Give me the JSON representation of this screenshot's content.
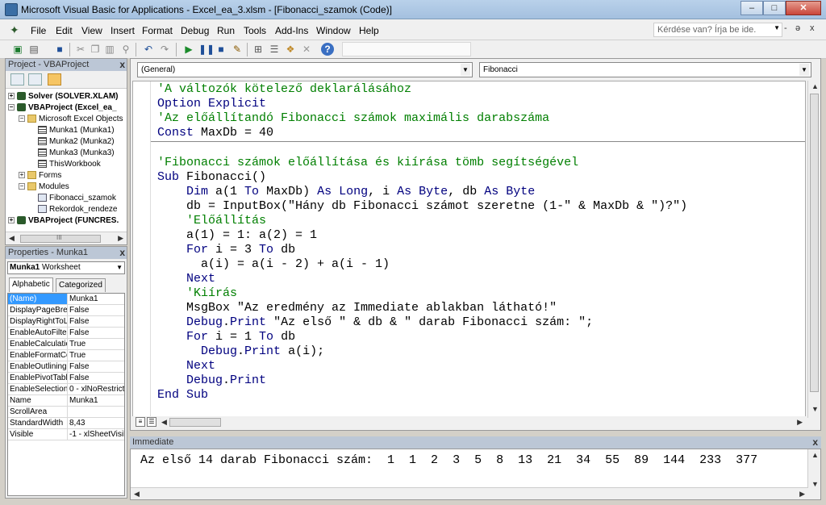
{
  "window": {
    "title": "Microsoft Visual Basic for Applications - Excel_ea_3.xlsm - [Fibonacci_szamok (Code)]",
    "min_label": "–",
    "max_label": "□",
    "close_label": "✕"
  },
  "menubar": {
    "items": [
      "File",
      "Edit",
      "View",
      "Insert",
      "Format",
      "Debug",
      "Run",
      "Tools",
      "Add-Ins",
      "Window",
      "Help"
    ],
    "help_placeholder": "Kérdése van? Írja be ide.",
    "mdi_min": "-",
    "mdi_restore": "ə",
    "mdi_close": "x"
  },
  "project": {
    "header": "Project - VBAProject",
    "close": "x",
    "tree": [
      {
        "label": "Solver (SOLVER.XLAM)",
        "bold": true
      },
      {
        "label": "VBAProject (Excel_ea_",
        "bold": true
      },
      {
        "label": "Microsoft Excel Objects"
      },
      {
        "label": "Munka1 (Munka1)"
      },
      {
        "label": "Munka2 (Munka2)"
      },
      {
        "label": "Munka3 (Munka3)"
      },
      {
        "label": "ThisWorkbook"
      },
      {
        "label": "Forms"
      },
      {
        "label": "Modules"
      },
      {
        "label": "Fibonacci_szamok"
      },
      {
        "label": "Rekordok_rendeze"
      },
      {
        "label": "VBAProject (FUNCRES.",
        "bold": true
      }
    ],
    "scroll_thumb_label": "III"
  },
  "properties": {
    "header": "Properties - Munka1",
    "close": "x",
    "object_name": "Munka1",
    "object_type": "Worksheet",
    "tabs": [
      "Alphabetic",
      "Categorized"
    ],
    "rows": [
      {
        "name": "(Name)",
        "value": "Munka1",
        "selected": true
      },
      {
        "name": "DisplayPageBrea",
        "value": "False"
      },
      {
        "name": "DisplayRightToLe",
        "value": "False"
      },
      {
        "name": "EnableAutoFilter",
        "value": "False"
      },
      {
        "name": "EnableCalculatio",
        "value": "True"
      },
      {
        "name": "EnableFormatCo",
        "value": "True"
      },
      {
        "name": "EnableOutlining",
        "value": "False"
      },
      {
        "name": "EnablePivotTable",
        "value": "False"
      },
      {
        "name": "EnableSelection",
        "value": "0 - xlNoRestrict"
      },
      {
        "name": "Name",
        "value": "Munka1"
      },
      {
        "name": "ScrollArea",
        "value": ""
      },
      {
        "name": "StandardWidth",
        "value": "8,43"
      },
      {
        "name": "Visible",
        "value": "-1 - xlSheetVisil"
      }
    ]
  },
  "code": {
    "object_combo": "(General)",
    "proc_combo": "Fibonacci",
    "lines": [
      "'A változók kötelező deklarálásához",
      "Option Explicit",
      "'Az előállítandó Fibonacci számok maximális darabszáma",
      "Const MaxDb = 40",
      "'Fibonacci számok előállítása és kiírása tömb segítségével",
      "Sub Fibonacci()",
      "    Dim a(1 To MaxDb) As Long, i As Byte, db As Byte",
      "    db = InputBox(\"Hány db Fibonacci számot szeretne (1-\" & MaxDb & \")?\")",
      "    'Előállítás",
      "    a(1) = 1: a(2) = 1",
      "    For i = 3 To db",
      "      a(i) = a(i - 2) + a(i - 1)",
      "    Next",
      "    'Kiírás",
      "    MsgBox \"Az eredmény az Immediate ablakban látható!\"",
      "    Debug.Print \"Az első \" & db & \" darab Fibonacci szám: \";",
      "    For i = 1 To db",
      "      Debug.Print a(i);",
      "    Next",
      "    Debug.Print",
      "End Sub"
    ]
  },
  "immediate": {
    "header": "Immediate",
    "close": "x",
    "output": "Az első 14 darab Fibonacci szám:  1  1  2  3  5  8  13  21  34  55  89  144  233  377"
  }
}
